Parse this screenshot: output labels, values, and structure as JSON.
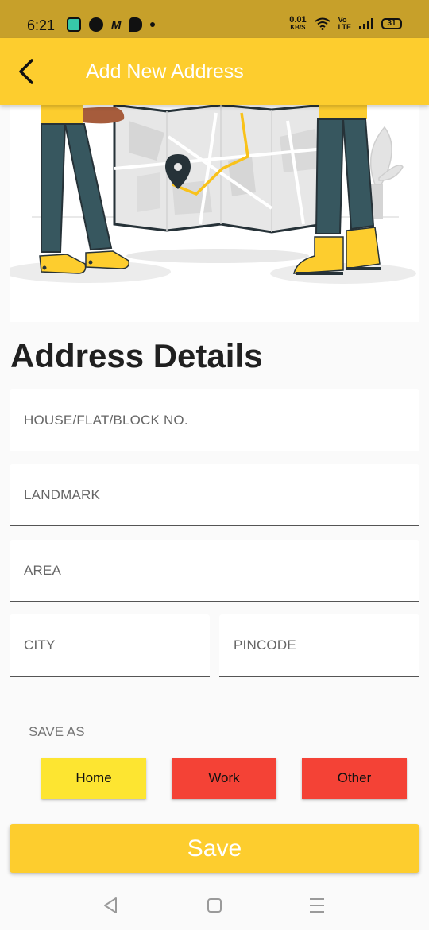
{
  "status_bar": {
    "time": "6:21",
    "speed_value": "0.01",
    "speed_unit": "KB/S",
    "network_label_top": "Vo",
    "network_label_bottom": "LTE",
    "battery": "31"
  },
  "app_bar": {
    "title": "Add New Address"
  },
  "form": {
    "section_title": "Address Details",
    "house_placeholder": "HOUSE/FLAT/BLOCK NO.",
    "landmark_placeholder": "LANDMARK",
    "area_placeholder": "AREA",
    "city_placeholder": "CITY",
    "pincode_placeholder": "PINCODE",
    "save_as_label": "SAVE AS",
    "options": {
      "home": "Home",
      "work": "Work",
      "other": "Other"
    },
    "selected_option": "Home"
  },
  "save_label": "Save",
  "colors": {
    "accent": "#fdcd2e",
    "selected_chip": "#fde531",
    "unselected_chip": "#f44236",
    "status_bar": "#c7a02a"
  }
}
